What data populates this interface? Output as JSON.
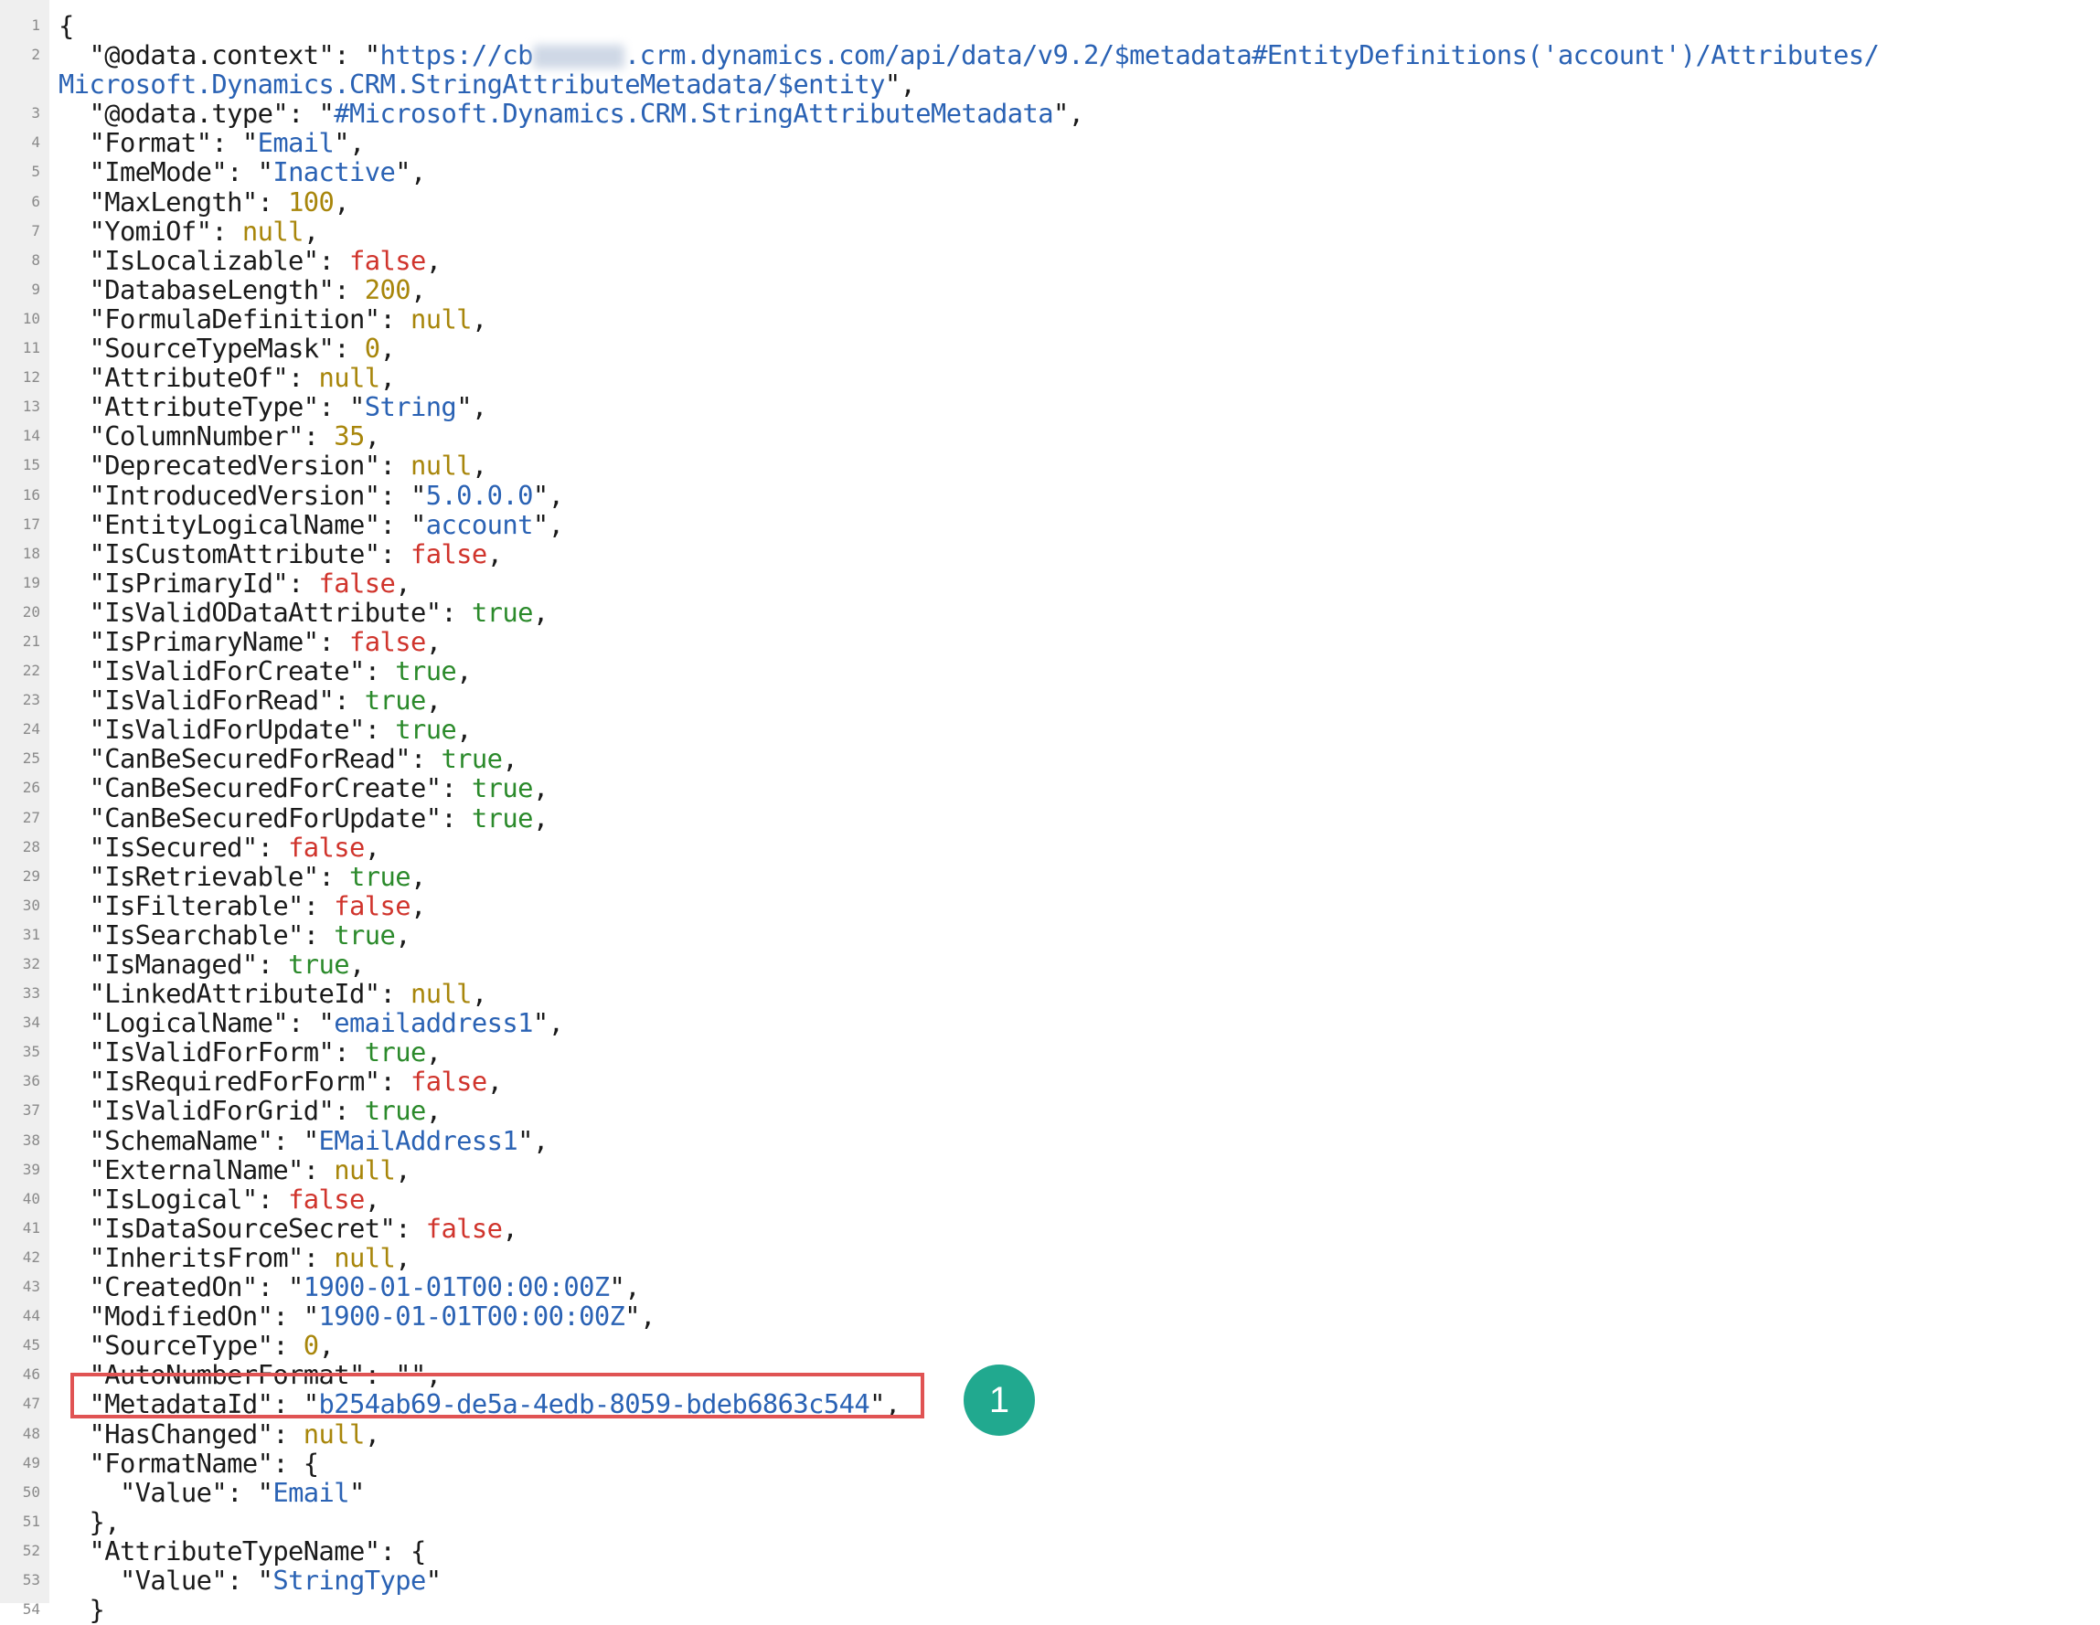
{
  "callout": {
    "label": "1"
  },
  "lines": [
    [
      {
        "t": "{"
      }
    ],
    [
      {
        "t": "  \"@odata.context\": \""
      },
      {
        "t": "https://cb",
        "c": "s"
      },
      {
        "blur": true
      },
      {
        "t": ".crm.dynamics.com/api/data/v9.2/$metadata#EntityDefinitions('account')/Attributes/",
        "c": "s"
      }
    ],
    [
      {
        "t": "Microsoft.Dynamics.CRM.StringAttributeMetadata/$entity",
        "c": "s"
      },
      {
        "t": "\","
      }
    ],
    [
      {
        "t": "  \"@odata.type\": \""
      },
      {
        "t": "#Microsoft.Dynamics.CRM.StringAttributeMetadata",
        "c": "s"
      },
      {
        "t": "\","
      }
    ],
    [
      {
        "t": "  \"Format\": \""
      },
      {
        "t": "Email",
        "c": "s"
      },
      {
        "t": "\","
      }
    ],
    [
      {
        "t": "  \"ImeMode\": \""
      },
      {
        "t": "Inactive",
        "c": "s"
      },
      {
        "t": "\","
      }
    ],
    [
      {
        "t": "  \"MaxLength\": "
      },
      {
        "t": "100",
        "c": "n"
      },
      {
        "t": ","
      }
    ],
    [
      {
        "t": "  \"YomiOf\": "
      },
      {
        "t": "null",
        "c": "n"
      },
      {
        "t": ","
      }
    ],
    [
      {
        "t": "  \"IsLocalizable\": "
      },
      {
        "t": "false",
        "c": "f"
      },
      {
        "t": ","
      }
    ],
    [
      {
        "t": "  \"DatabaseLength\": "
      },
      {
        "t": "200",
        "c": "n"
      },
      {
        "t": ","
      }
    ],
    [
      {
        "t": "  \"FormulaDefinition\": "
      },
      {
        "t": "null",
        "c": "n"
      },
      {
        "t": ","
      }
    ],
    [
      {
        "t": "  \"SourceTypeMask\": "
      },
      {
        "t": "0",
        "c": "n"
      },
      {
        "t": ","
      }
    ],
    [
      {
        "t": "  \"AttributeOf\": "
      },
      {
        "t": "null",
        "c": "n"
      },
      {
        "t": ","
      }
    ],
    [
      {
        "t": "  \"AttributeType\": \""
      },
      {
        "t": "String",
        "c": "s"
      },
      {
        "t": "\","
      }
    ],
    [
      {
        "t": "  \"ColumnNumber\": "
      },
      {
        "t": "35",
        "c": "n"
      },
      {
        "t": ","
      }
    ],
    [
      {
        "t": "  \"DeprecatedVersion\": "
      },
      {
        "t": "null",
        "c": "n"
      },
      {
        "t": ","
      }
    ],
    [
      {
        "t": "  \"IntroducedVersion\": \""
      },
      {
        "t": "5.0.0.0",
        "c": "s"
      },
      {
        "t": "\","
      }
    ],
    [
      {
        "t": "  \"EntityLogicalName\": \""
      },
      {
        "t": "account",
        "c": "s"
      },
      {
        "t": "\","
      }
    ],
    [
      {
        "t": "  \"IsCustomAttribute\": "
      },
      {
        "t": "false",
        "c": "f"
      },
      {
        "t": ","
      }
    ],
    [
      {
        "t": "  \"IsPrimaryId\": "
      },
      {
        "t": "false",
        "c": "f"
      },
      {
        "t": ","
      }
    ],
    [
      {
        "t": "  \"IsValidODataAttribute\": "
      },
      {
        "t": "true",
        "c": "t"
      },
      {
        "t": ","
      }
    ],
    [
      {
        "t": "  \"IsPrimaryName\": "
      },
      {
        "t": "false",
        "c": "f"
      },
      {
        "t": ","
      }
    ],
    [
      {
        "t": "  \"IsValidForCreate\": "
      },
      {
        "t": "true",
        "c": "t"
      },
      {
        "t": ","
      }
    ],
    [
      {
        "t": "  \"IsValidForRead\": "
      },
      {
        "t": "true",
        "c": "t"
      },
      {
        "t": ","
      }
    ],
    [
      {
        "t": "  \"IsValidForUpdate\": "
      },
      {
        "t": "true",
        "c": "t"
      },
      {
        "t": ","
      }
    ],
    [
      {
        "t": "  \"CanBeSecuredForRead\": "
      },
      {
        "t": "true",
        "c": "t"
      },
      {
        "t": ","
      }
    ],
    [
      {
        "t": "  \"CanBeSecuredForCreate\": "
      },
      {
        "t": "true",
        "c": "t"
      },
      {
        "t": ","
      }
    ],
    [
      {
        "t": "  \"CanBeSecuredForUpdate\": "
      },
      {
        "t": "true",
        "c": "t"
      },
      {
        "t": ","
      }
    ],
    [
      {
        "t": "  \"IsSecured\": "
      },
      {
        "t": "false",
        "c": "f"
      },
      {
        "t": ","
      }
    ],
    [
      {
        "t": "  \"IsRetrievable\": "
      },
      {
        "t": "true",
        "c": "t"
      },
      {
        "t": ","
      }
    ],
    [
      {
        "t": "  \"IsFilterable\": "
      },
      {
        "t": "false",
        "c": "f"
      },
      {
        "t": ","
      }
    ],
    [
      {
        "t": "  \"IsSearchable\": "
      },
      {
        "t": "true",
        "c": "t"
      },
      {
        "t": ","
      }
    ],
    [
      {
        "t": "  \"IsManaged\": "
      },
      {
        "t": "true",
        "c": "t"
      },
      {
        "t": ","
      }
    ],
    [
      {
        "t": "  \"LinkedAttributeId\": "
      },
      {
        "t": "null",
        "c": "n"
      },
      {
        "t": ","
      }
    ],
    [
      {
        "t": "  \"LogicalName\": \""
      },
      {
        "t": "emailaddress1",
        "c": "s"
      },
      {
        "t": "\","
      }
    ],
    [
      {
        "t": "  \"IsValidForForm\": "
      },
      {
        "t": "true",
        "c": "t"
      },
      {
        "t": ","
      }
    ],
    [
      {
        "t": "  \"IsRequiredForForm\": "
      },
      {
        "t": "false",
        "c": "f"
      },
      {
        "t": ","
      }
    ],
    [
      {
        "t": "  \"IsValidForGrid\": "
      },
      {
        "t": "true",
        "c": "t"
      },
      {
        "t": ","
      }
    ],
    [
      {
        "t": "  \"SchemaName\": \""
      },
      {
        "t": "EMailAddress1",
        "c": "s"
      },
      {
        "t": "\","
      }
    ],
    [
      {
        "t": "  \"ExternalName\": "
      },
      {
        "t": "null",
        "c": "n"
      },
      {
        "t": ","
      }
    ],
    [
      {
        "t": "  \"IsLogical\": "
      },
      {
        "t": "false",
        "c": "f"
      },
      {
        "t": ","
      }
    ],
    [
      {
        "t": "  \"IsDataSourceSecret\": "
      },
      {
        "t": "false",
        "c": "f"
      },
      {
        "t": ","
      }
    ],
    [
      {
        "t": "  \"InheritsFrom\": "
      },
      {
        "t": "null",
        "c": "n"
      },
      {
        "t": ","
      }
    ],
    [
      {
        "t": "  \"CreatedOn\": \""
      },
      {
        "t": "1900-01-01T00:00:00Z",
        "c": "s"
      },
      {
        "t": "\","
      }
    ],
    [
      {
        "t": "  \"ModifiedOn\": \""
      },
      {
        "t": "1900-01-01T00:00:00Z",
        "c": "s"
      },
      {
        "t": "\","
      }
    ],
    [
      {
        "t": "  \"SourceType\": "
      },
      {
        "t": "0",
        "c": "n"
      },
      {
        "t": ","
      }
    ],
    [
      {
        "t": "  \"AutoNumberFormat\": \"\","
      }
    ],
    [
      {
        "t": "  \"MetadataId\": \""
      },
      {
        "t": "b254ab69-de5a-4edb-8059-bdeb6863c544",
        "c": "s"
      },
      {
        "t": "\","
      }
    ],
    [
      {
        "t": "  \"HasChanged\": "
      },
      {
        "t": "null",
        "c": "n"
      },
      {
        "t": ","
      }
    ],
    [
      {
        "t": "  \"FormatName\": {"
      }
    ],
    [
      {
        "t": "    \"Value\": \""
      },
      {
        "t": "Email",
        "c": "s"
      },
      {
        "t": "\""
      }
    ],
    [
      {
        "t": "  },"
      }
    ],
    [
      {
        "t": "  \"AttributeTypeName\": {"
      }
    ],
    [
      {
        "t": "    \"Value\": \""
      },
      {
        "t": "StringType",
        "c": "s"
      },
      {
        "t": "\""
      }
    ],
    [
      {
        "t": "  }"
      }
    ]
  ],
  "line_numbers": [
    "1",
    "2",
    "",
    "3",
    "4",
    "5",
    "6",
    "7",
    "8",
    "9",
    "10",
    "11",
    "12",
    "13",
    "14",
    "15",
    "16",
    "17",
    "18",
    "19",
    "20",
    "21",
    "22",
    "23",
    "24",
    "25",
    "26",
    "27",
    "28",
    "29",
    "30",
    "31",
    "32",
    "33",
    "34",
    "35",
    "36",
    "37",
    "38",
    "39",
    "40",
    "41",
    "42",
    "43",
    "44",
    "45",
    "46",
    "47",
    "48",
    "49",
    "50",
    "51",
    "52",
    "53",
    "54"
  ]
}
